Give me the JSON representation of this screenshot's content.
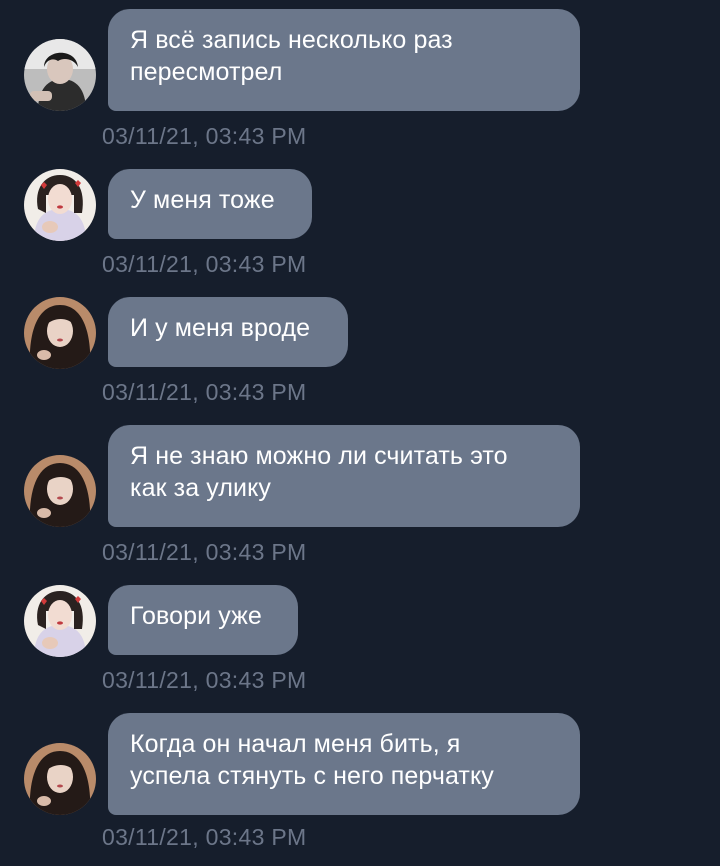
{
  "messages": [
    {
      "avatar": "avatar-boy-dark-hair",
      "lines": [
        "Я всё запись несколько раз",
        "пересмотрел"
      ],
      "time": "03/11/21, 03:43 PM"
    },
    {
      "avatar": "avatar-girl-hearts",
      "lines": [
        "У меня тоже"
      ],
      "time": "03/11/21, 03:43 PM"
    },
    {
      "avatar": "avatar-girl-long-hair",
      "lines": [
        "И у меня вроде"
      ],
      "time": "03/11/21, 03:43 PM"
    },
    {
      "avatar": "avatar-girl-long-hair",
      "lines": [
        "Я не знаю можно ли считать это",
        "как за улику"
      ],
      "time": "03/11/21, 03:43 PM"
    },
    {
      "avatar": "avatar-girl-hearts",
      "lines": [
        "Говори уже"
      ],
      "time": "03/11/21, 03:43 PM"
    },
    {
      "avatar": "avatar-girl-long-hair",
      "lines": [
        "Когда он начал меня бить, я",
        "успела стянуть с него перчатку"
      ],
      "time": "03/11/21, 03:43 PM"
    }
  ],
  "colors": {
    "background": "#161e2c",
    "bubble": "#6b778b",
    "text": "#ffffff",
    "timestamp": "#6c7689"
  }
}
